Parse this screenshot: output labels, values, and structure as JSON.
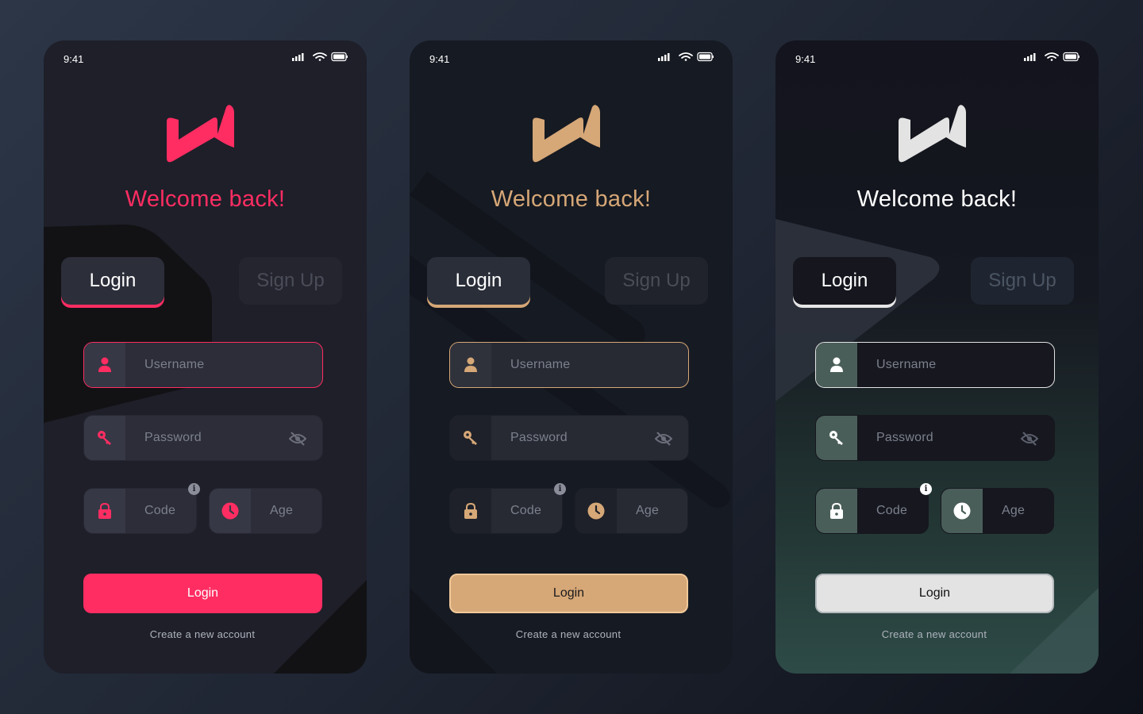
{
  "screens": [
    {
      "theme": "pink",
      "accent": "#ff2d62",
      "background": "#1e1f29",
      "status": {
        "time": "9:41"
      },
      "welcome": "Welcome back!",
      "tabs": {
        "login": "Login",
        "signup": "Sign Up"
      },
      "fields": {
        "username": "Username",
        "password": "Password",
        "code": "Code",
        "age": "Age"
      },
      "info_glyph": "i",
      "login_button": "Login",
      "create_account": "Create a new account"
    },
    {
      "theme": "gold",
      "accent": "#d6a777",
      "background": "#161a22",
      "status": {
        "time": "9:41"
      },
      "welcome": "Welcome back!",
      "tabs": {
        "login": "Login",
        "signup": "Sign Up"
      },
      "fields": {
        "username": "Username",
        "password": "Password",
        "code": "Code",
        "age": "Age"
      },
      "info_glyph": "i",
      "login_button": "Login",
      "create_account": "Create a new account"
    },
    {
      "theme": "white",
      "accent": "#e3e3e3",
      "background": "#13141d",
      "status": {
        "time": "9:41"
      },
      "welcome": "Welcome back!",
      "tabs": {
        "login": "Login",
        "signup": "Sign Up"
      },
      "fields": {
        "username": "Username",
        "password": "Password",
        "code": "Code",
        "age": "Age"
      },
      "info_glyph": "i",
      "login_button": "Login",
      "create_account": "Create a new account"
    }
  ]
}
